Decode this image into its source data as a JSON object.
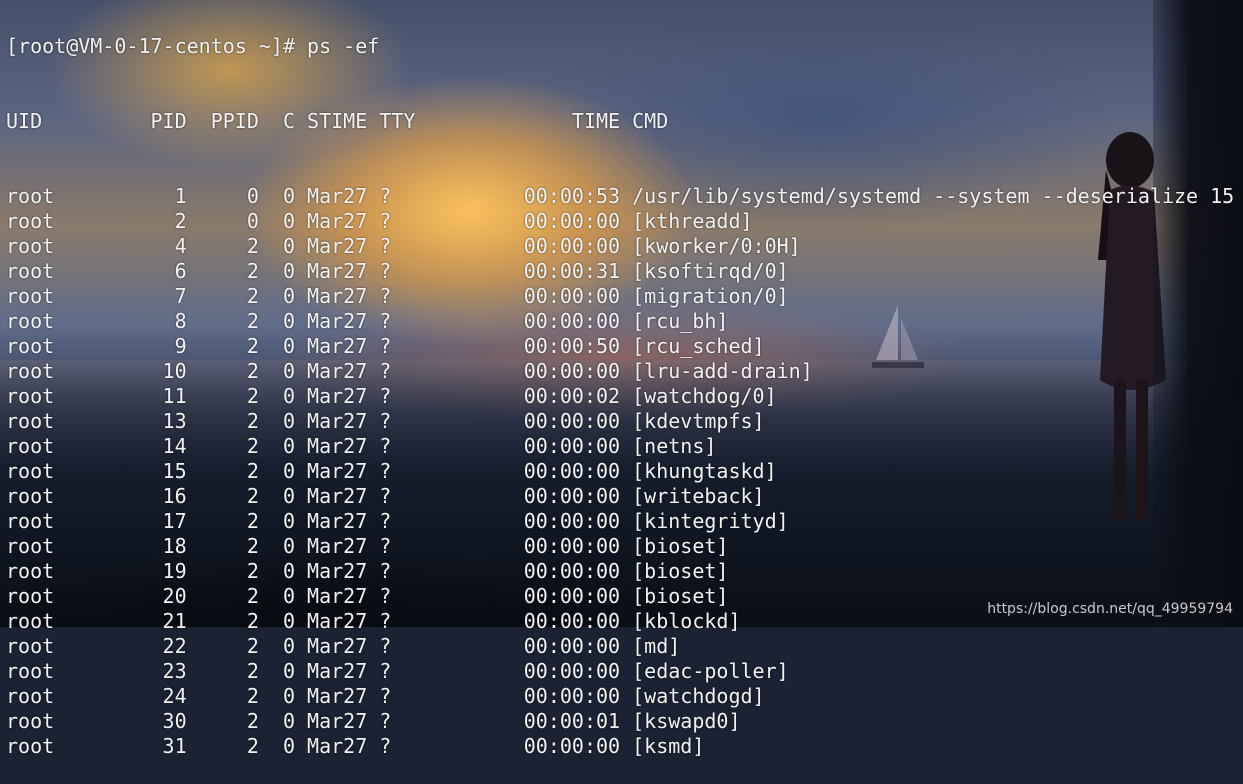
{
  "terminal": {
    "prompt": "[root@VM-0-17-centos ~]# ps -ef",
    "header": {
      "uid": "UID",
      "pid": "PID",
      "ppid": "PPID",
      "c": "C",
      "stime": "STIME",
      "tty": "TTY",
      "time": "TIME",
      "cmd": "CMD"
    },
    "rows": [
      {
        "uid": "root",
        "pid": "1",
        "ppid": "0",
        "c": "0",
        "stime": "Mar27",
        "tty": "?",
        "time": "00:00:53",
        "cmd": "/usr/lib/systemd/systemd --system --deserialize 15"
      },
      {
        "uid": "root",
        "pid": "2",
        "ppid": "0",
        "c": "0",
        "stime": "Mar27",
        "tty": "?",
        "time": "00:00:00",
        "cmd": "[kthreadd]"
      },
      {
        "uid": "root",
        "pid": "4",
        "ppid": "2",
        "c": "0",
        "stime": "Mar27",
        "tty": "?",
        "time": "00:00:00",
        "cmd": "[kworker/0:0H]"
      },
      {
        "uid": "root",
        "pid": "6",
        "ppid": "2",
        "c": "0",
        "stime": "Mar27",
        "tty": "?",
        "time": "00:00:31",
        "cmd": "[ksoftirqd/0]"
      },
      {
        "uid": "root",
        "pid": "7",
        "ppid": "2",
        "c": "0",
        "stime": "Mar27",
        "tty": "?",
        "time": "00:00:00",
        "cmd": "[migration/0]"
      },
      {
        "uid": "root",
        "pid": "8",
        "ppid": "2",
        "c": "0",
        "stime": "Mar27",
        "tty": "?",
        "time": "00:00:00",
        "cmd": "[rcu_bh]"
      },
      {
        "uid": "root",
        "pid": "9",
        "ppid": "2",
        "c": "0",
        "stime": "Mar27",
        "tty": "?",
        "time": "00:00:50",
        "cmd": "[rcu_sched]"
      },
      {
        "uid": "root",
        "pid": "10",
        "ppid": "2",
        "c": "0",
        "stime": "Mar27",
        "tty": "?",
        "time": "00:00:00",
        "cmd": "[lru-add-drain]"
      },
      {
        "uid": "root",
        "pid": "11",
        "ppid": "2",
        "c": "0",
        "stime": "Mar27",
        "tty": "?",
        "time": "00:00:02",
        "cmd": "[watchdog/0]"
      },
      {
        "uid": "root",
        "pid": "13",
        "ppid": "2",
        "c": "0",
        "stime": "Mar27",
        "tty": "?",
        "time": "00:00:00",
        "cmd": "[kdevtmpfs]"
      },
      {
        "uid": "root",
        "pid": "14",
        "ppid": "2",
        "c": "0",
        "stime": "Mar27",
        "tty": "?",
        "time": "00:00:00",
        "cmd": "[netns]"
      },
      {
        "uid": "root",
        "pid": "15",
        "ppid": "2",
        "c": "0",
        "stime": "Mar27",
        "tty": "?",
        "time": "00:00:00",
        "cmd": "[khungtaskd]"
      },
      {
        "uid": "root",
        "pid": "16",
        "ppid": "2",
        "c": "0",
        "stime": "Mar27",
        "tty": "?",
        "time": "00:00:00",
        "cmd": "[writeback]"
      },
      {
        "uid": "root",
        "pid": "17",
        "ppid": "2",
        "c": "0",
        "stime": "Mar27",
        "tty": "?",
        "time": "00:00:00",
        "cmd": "[kintegrityd]"
      },
      {
        "uid": "root",
        "pid": "18",
        "ppid": "2",
        "c": "0",
        "stime": "Mar27",
        "tty": "?",
        "time": "00:00:00",
        "cmd": "[bioset]"
      },
      {
        "uid": "root",
        "pid": "19",
        "ppid": "2",
        "c": "0",
        "stime": "Mar27",
        "tty": "?",
        "time": "00:00:00",
        "cmd": "[bioset]"
      },
      {
        "uid": "root",
        "pid": "20",
        "ppid": "2",
        "c": "0",
        "stime": "Mar27",
        "tty": "?",
        "time": "00:00:00",
        "cmd": "[bioset]"
      },
      {
        "uid": "root",
        "pid": "21",
        "ppid": "2",
        "c": "0",
        "stime": "Mar27",
        "tty": "?",
        "time": "00:00:00",
        "cmd": "[kblockd]"
      },
      {
        "uid": "root",
        "pid": "22",
        "ppid": "2",
        "c": "0",
        "stime": "Mar27",
        "tty": "?",
        "time": "00:00:00",
        "cmd": "[md]"
      },
      {
        "uid": "root",
        "pid": "23",
        "ppid": "2",
        "c": "0",
        "stime": "Mar27",
        "tty": "?",
        "time": "00:00:00",
        "cmd": "[edac-poller]"
      },
      {
        "uid": "root",
        "pid": "24",
        "ppid": "2",
        "c": "0",
        "stime": "Mar27",
        "tty": "?",
        "time": "00:00:00",
        "cmd": "[watchdogd]"
      },
      {
        "uid": "root",
        "pid": "30",
        "ppid": "2",
        "c": "0",
        "stime": "Mar27",
        "tty": "?",
        "time": "00:00:01",
        "cmd": "[kswapd0]"
      },
      {
        "uid": "root",
        "pid": "31",
        "ppid": "2",
        "c": "0",
        "stime": "Mar27",
        "tty": "?",
        "time": "00:00:00",
        "cmd": "[ksmd]"
      }
    ]
  },
  "watermark": "https://blog.csdn.net/qq_49959794",
  "colors": {
    "text": "#f2f2f2"
  }
}
